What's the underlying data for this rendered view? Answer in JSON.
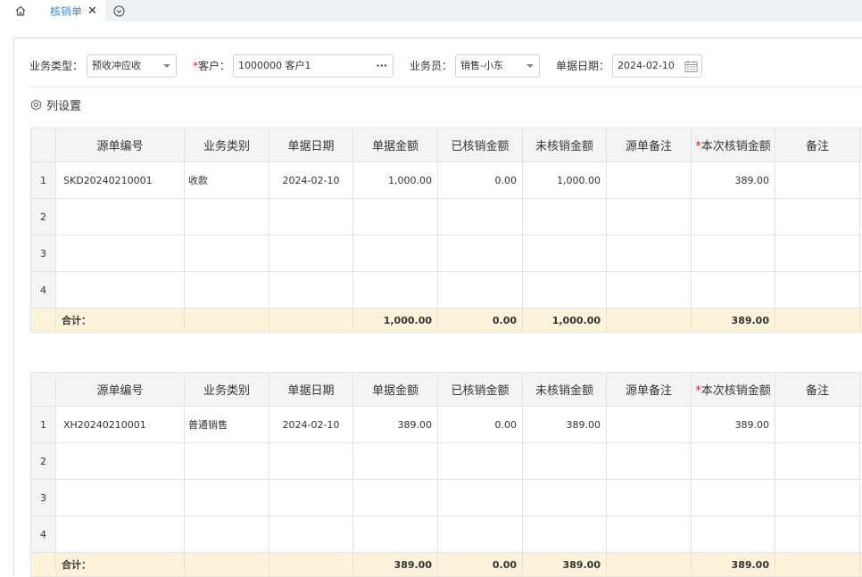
{
  "tabs": {
    "active_label": "核销单"
  },
  "form": {
    "biz_type_label": "业务类型：",
    "biz_type_value": "预收冲应收",
    "customer_label": "客户：",
    "customer_value": "1000000 客户1",
    "salesman_label": "业务员：",
    "salesman_value": "销售-小东",
    "date_label": "单据日期：",
    "date_value": "2024-02-10"
  },
  "column_settings": "列设置",
  "columns": [
    "源单编号",
    "业务类别",
    "单据日期",
    "单据金额",
    "已核销金额",
    "未核销金额",
    "源单备注",
    "本次核销金额",
    "备注"
  ],
  "receipt_table": {
    "rows": [
      {
        "no": "1",
        "code": "SKD20240210001",
        "category": "收款",
        "date": "2024-02-10",
        "amount": "1,000.00",
        "verified": "0.00",
        "unverified": "1,000.00",
        "remark": "",
        "this_time": "389.00",
        "note": ""
      },
      {
        "no": "2"
      },
      {
        "no": "3"
      },
      {
        "no": "4"
      }
    ],
    "total": {
      "label": "合计：",
      "amount": "1,000.00",
      "verified": "0.00",
      "unverified": "1,000.00",
      "this_time": "389.00"
    }
  },
  "sales_table": {
    "rows": [
      {
        "no": "1",
        "code": "XH20240210001",
        "category": "普通销售",
        "date": "2024-02-10",
        "amount": "389.00",
        "verified": "0.00",
        "unverified": "389.00",
        "remark": "",
        "this_time": "389.00",
        "note": ""
      },
      {
        "no": "2"
      },
      {
        "no": "3"
      },
      {
        "no": "4"
      }
    ],
    "total": {
      "label": "合计：",
      "amount": "389.00",
      "verified": "0.00",
      "unverified": "389.00",
      "this_time": "389.00"
    }
  }
}
